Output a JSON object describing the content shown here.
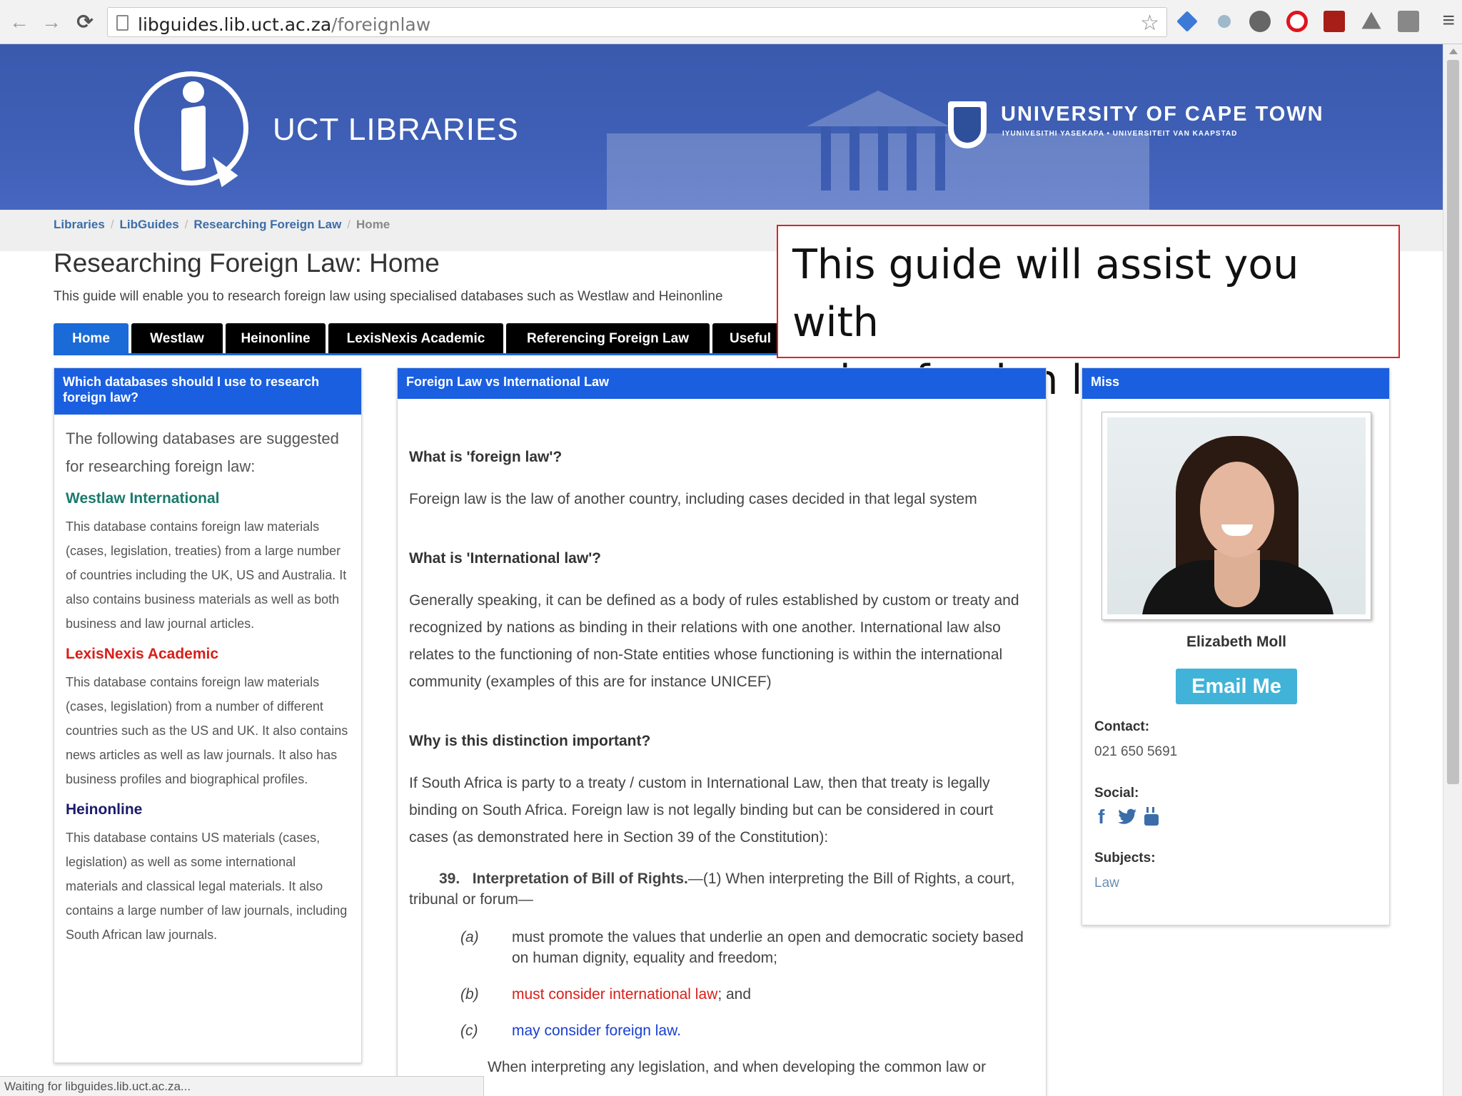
{
  "browser": {
    "url_host": "libguides.lib.uct.ac.za",
    "url_path": "/foreignlaw",
    "back_icon": "arrow-left-icon",
    "forward_icon": "arrow-right-icon",
    "reload_icon": "reload-icon",
    "bookmark_icon": "star-icon",
    "menu_icon": "hamburger-menu-icon",
    "status_text": "Waiting for libguides.lib.uct.ac.za..."
  },
  "banner": {
    "site_title": "UCT LIBRARIES",
    "university_name": "UNIVERSITY OF CAPE TOWN",
    "university_subtitle": "IYUNIVESITHI YASEKAPA • UNIVERSITEIT VAN KAAPSTAD",
    "bg_color": "#3e5fb5"
  },
  "breadcrumb": {
    "items": [
      "Libraries",
      "LibGuides",
      "Researching Foreign Law"
    ],
    "current": "Home"
  },
  "page": {
    "title": "Researching Foreign Law: Home",
    "description": "This guide will enable you to research foreign law using specialised databases such as Westlaw and Heinonline"
  },
  "tabs": [
    {
      "label": "Home",
      "active": true
    },
    {
      "label": "Westlaw",
      "active": false
    },
    {
      "label": "Heinonline",
      "active": false
    },
    {
      "label": "LexisNexis Academic",
      "active": false
    },
    {
      "label": "Referencing Foreign Law",
      "active": false
    },
    {
      "label": "Useful",
      "active": false
    }
  ],
  "callout": {
    "line1": "This guide will assist you with",
    "line2": "using foreign law resources",
    "border_color": "#d9252b"
  },
  "left_box": {
    "heading": "Which databases should I use to research foreign law?",
    "intro": "The following databases are suggested for researching foreign law:",
    "databases": [
      {
        "name": "Westlaw International",
        "description": "This database contains foreign law materials (cases, legislation, treaties) from a large number of countries including the UK, US and Australia. It also contains business materials as well as both business and law journal articles."
      },
      {
        "name": "LexisNexis Academic",
        "description": "This database contains foreign law materials (cases, legislation) from a number of different countries such as the US and UK. It also contains news articles as well as law journals. It also has business profiles and biographical profiles."
      },
      {
        "name": "Heinonline",
        "description": "This database contains US materials (cases, legislation) as well as some international materials and classical legal materials. It also contains a large number of law journals, including South African law journals."
      }
    ]
  },
  "mid_box": {
    "heading": "Foreign Law vs International Law",
    "sections": [
      {
        "question": "What is 'foreign law'?",
        "answer": "Foreign law is the law of another country, including cases decided in that legal system"
      },
      {
        "question": "What is 'International law'?",
        "answer": "Generally speaking, it can be defined as a body of rules established by custom or treaty and recognized by nations as binding in their relations with one another. International law also relates to the functioning of non-State entities whose functioning is within the international community (examples of this are for instance UNICEF)"
      },
      {
        "question": "Why is this distinction important?",
        "answer": "If South Africa is party to a treaty / custom in International Law, then that treaty is legally binding on South Africa. Foreign law is not legally binding but can be considered in court cases (as demonstrated here in Section 39 of the Constitution):"
      }
    ],
    "constitution": {
      "number": "39.",
      "title": "Interpretation of Bill of Rights.",
      "lead": "—(1)  When interpreting the Bill of Rights, a court, tribunal or forum—",
      "clauses": [
        {
          "label": "(a)",
          "text": "must promote the values that underlie an open and democratic society based on human dignity, equality and freedom;"
        },
        {
          "label": "(b)",
          "highlight": "must consider international law",
          "rest": "; and"
        },
        {
          "label": "(c)",
          "highlight": "may consider foreign law."
        }
      ],
      "cut_line": "When interpreting any legislation, and when developing the common law or"
    }
  },
  "right_box": {
    "heading": "Miss",
    "name": "Elizabeth Moll",
    "email_button": "Email Me",
    "contact_label": "Contact:",
    "contact_value": "021 650 5691",
    "social_label": "Social:",
    "social_icons": [
      "facebook-icon",
      "twitter-icon",
      "youtube-icon"
    ],
    "subjects_label": "Subjects:",
    "subject": "Law"
  }
}
